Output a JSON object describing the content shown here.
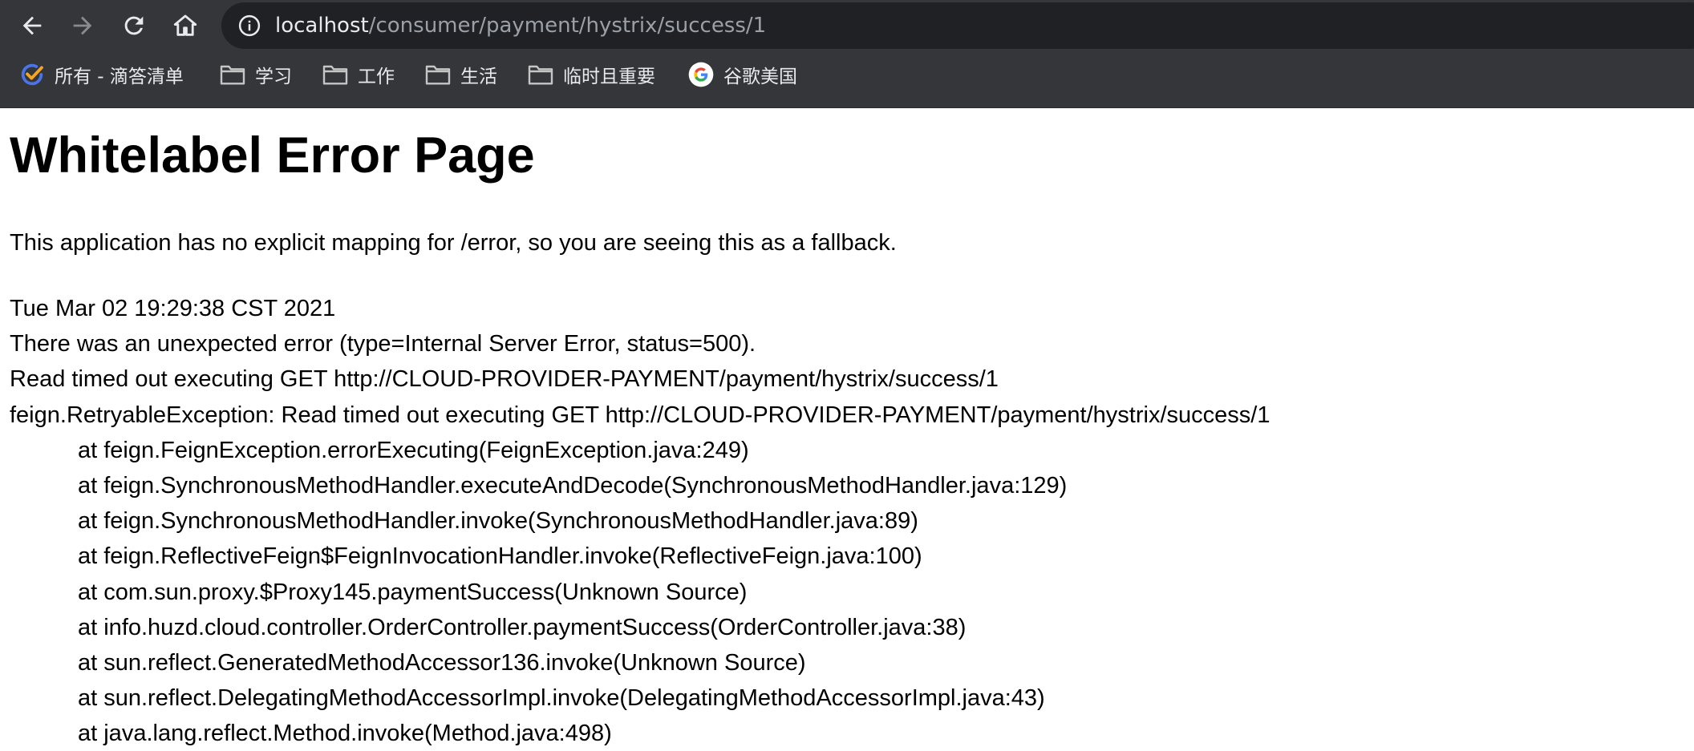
{
  "browser": {
    "address": {
      "host": "localhost",
      "path": "/consumer/payment/hystrix/success/1"
    },
    "bookmarks": [
      {
        "label": "所有 - 滴答清单",
        "icon": "dida-check-icon"
      },
      {
        "label": "学习",
        "icon": "folder-icon"
      },
      {
        "label": "工作",
        "icon": "folder-icon"
      },
      {
        "label": "生活",
        "icon": "folder-icon"
      },
      {
        "label": "临时且重要",
        "icon": "folder-icon"
      },
      {
        "label": "谷歌美国",
        "icon": "google-icon"
      }
    ],
    "colors": {
      "toolbar": "#35363a",
      "omnibox": "#202124",
      "url_host": "#e8eaed",
      "url_path": "#9aa0a6"
    }
  },
  "page": {
    "title": "Whitelabel Error Page",
    "description": "This application has no explicit mapping for /error, so you are seeing this as a fallback.",
    "lines": [
      "Tue Mar 02 19:29:38 CST 2021",
      "There was an unexpected error (type=Internal Server Error, status=500).",
      "Read timed out executing GET http://CLOUD-PROVIDER-PAYMENT/payment/hystrix/success/1",
      "feign.RetryableException: Read timed out executing GET http://CLOUD-PROVIDER-PAYMENT/payment/hystrix/success/1"
    ],
    "stack": [
      "at feign.FeignException.errorExecuting(FeignException.java:249)",
      "at feign.SynchronousMethodHandler.executeAndDecode(SynchronousMethodHandler.java:129)",
      "at feign.SynchronousMethodHandler.invoke(SynchronousMethodHandler.java:89)",
      "at feign.ReflectiveFeign$FeignInvocationHandler.invoke(ReflectiveFeign.java:100)",
      "at com.sun.proxy.$Proxy145.paymentSuccess(Unknown Source)",
      "at info.huzd.cloud.controller.OrderController.paymentSuccess(OrderController.java:38)",
      "at sun.reflect.GeneratedMethodAccessor136.invoke(Unknown Source)",
      "at sun.reflect.DelegatingMethodAccessorImpl.invoke(DelegatingMethodAccessorImpl.java:43)",
      "at java.lang.reflect.Method.invoke(Method.java:498)"
    ]
  }
}
